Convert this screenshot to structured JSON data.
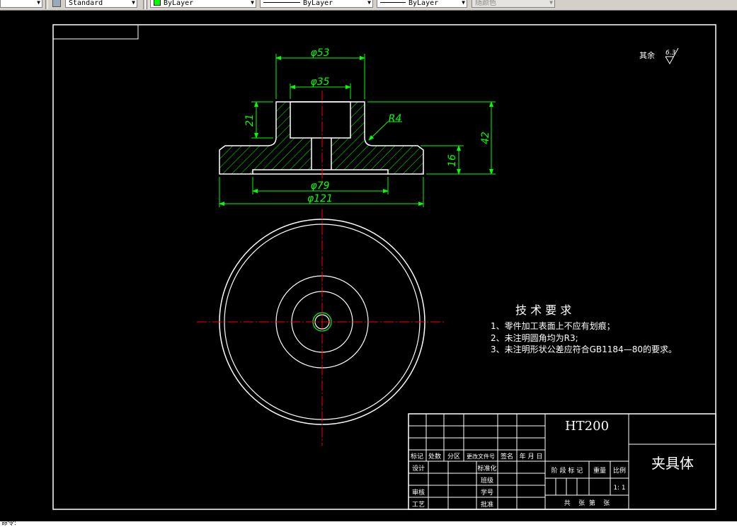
{
  "toolbar": {
    "text_style": "Standard",
    "layer_color": "ByLayer",
    "linetype": "ByLayer",
    "lineweight": "ByLayer",
    "plot_style": "随颜色",
    "layer_swatch_color": "#00ff00"
  },
  "drawing": {
    "colors": {
      "geometry": "#ffffff",
      "dimension": "#00ff00",
      "centerline": "#ff0000",
      "text": "#ffffff"
    },
    "dims": {
      "d53": "φ53",
      "d35": "φ35",
      "d79": "φ79",
      "d121": "φ121",
      "h21": "21",
      "h42": "42",
      "h16": "16",
      "r4": "R4"
    },
    "roughness": {
      "label": "其余",
      "value": "6.3"
    },
    "tech": {
      "title": "技 术 要 求",
      "items": [
        "1、零件加工表面上不应有划痕；",
        "2、未注明圆角均为R3;",
        "3、未注明形状公差应符合GB1184—80的要求。"
      ]
    },
    "title_block": {
      "material": "HT200",
      "part_name": "夹具体",
      "rev_headers": [
        "标记",
        "处数",
        "分区",
        "更改文件号",
        "签名",
        "年 月 日"
      ],
      "row_labels": [
        "设计",
        "审核",
        "工艺"
      ],
      "mid_labels": [
        "标准化",
        "班级",
        "学号",
        "批准"
      ],
      "stage_header": "阶 段 标 记",
      "weight_label": "重量",
      "scale_label": "比例",
      "scale_value": "1: 1",
      "sheet_text": "共    张  第    张"
    }
  },
  "command_line": "命令:"
}
